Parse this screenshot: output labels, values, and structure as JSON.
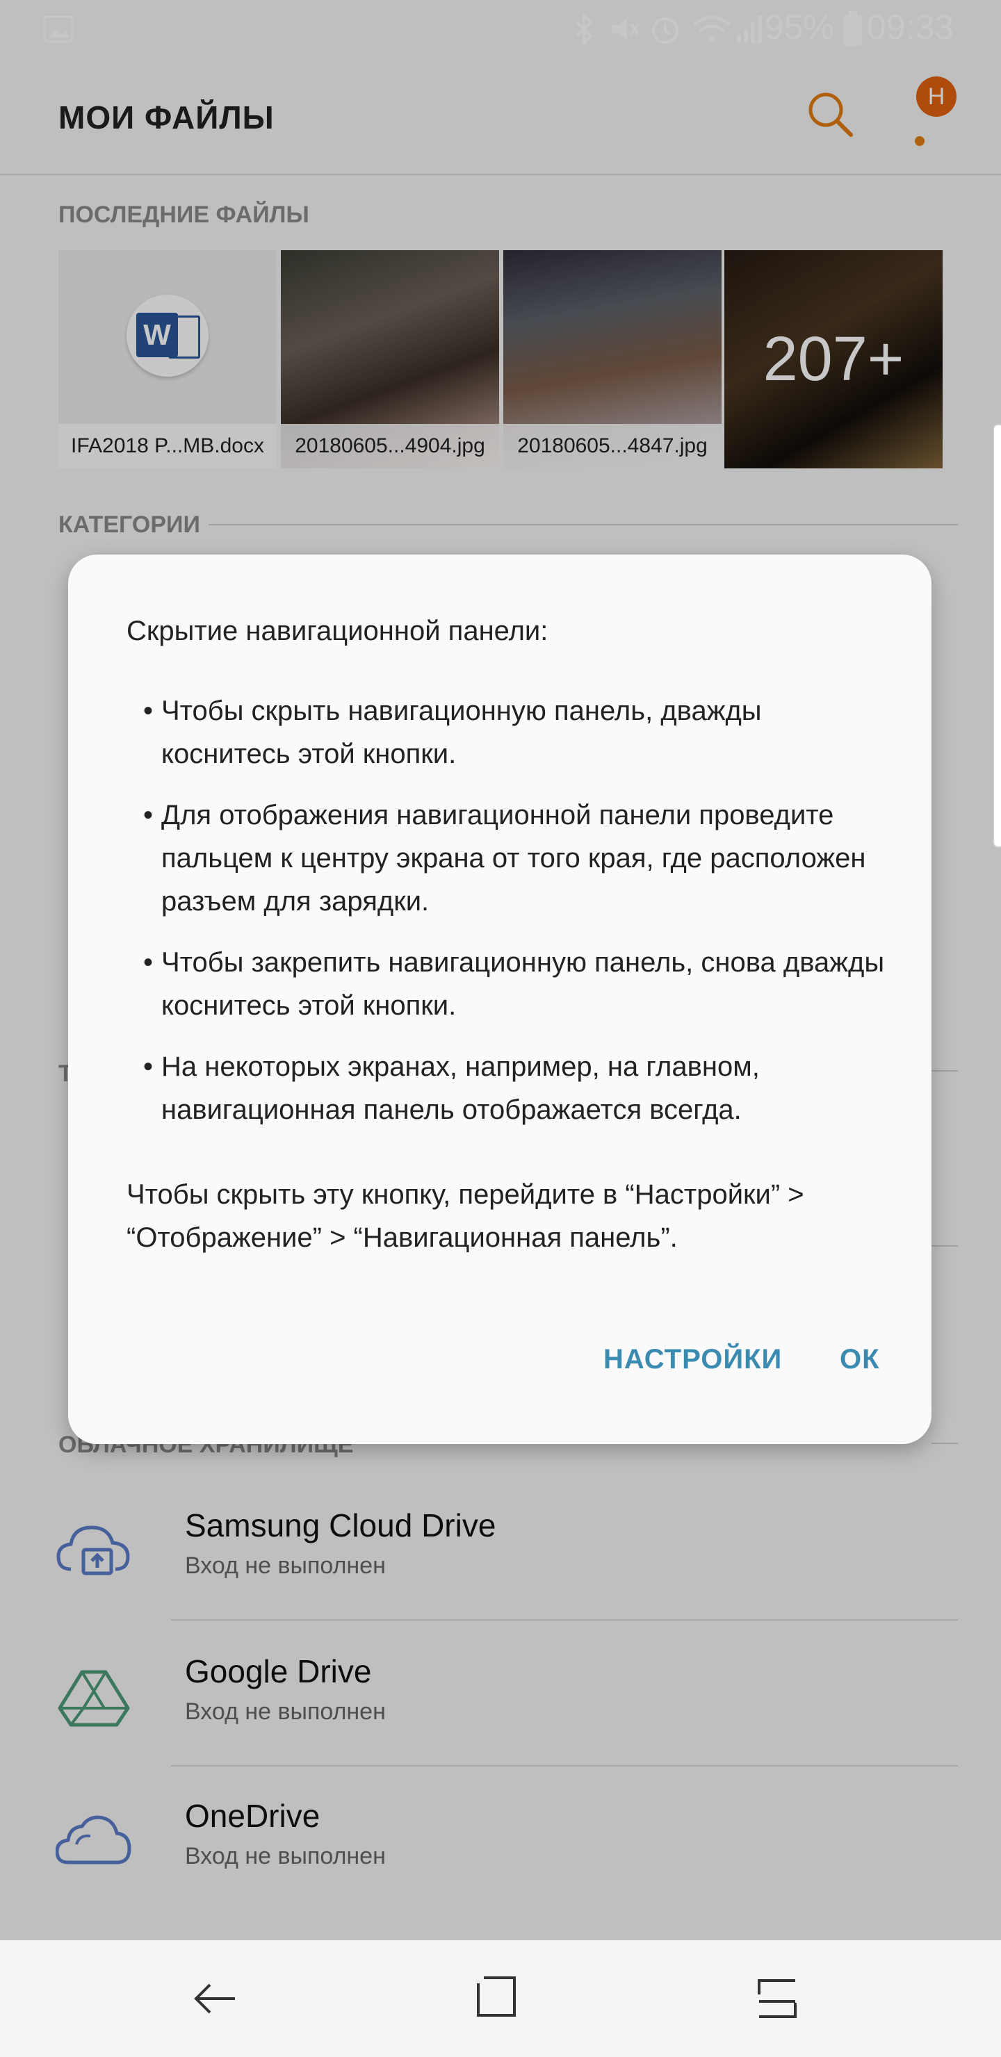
{
  "status_bar": {
    "battery": "95%",
    "time": "09:33"
  },
  "app_bar": {
    "title": "МОИ ФАЙЛЫ",
    "profile_initial": "Н"
  },
  "sections": {
    "recent": "ПОСЛЕДНИЕ ФАЙЛЫ",
    "categories": "КАТЕГОРИИ",
    "storage_partial": "Т",
    "cloud": "ОБЛАЧНОЕ ХРАНИЛИЩЕ"
  },
  "recent_files": [
    {
      "caption": "IFA2018 P...MB.docx"
    },
    {
      "caption": "20180605...4904.jpg"
    },
    {
      "caption": "20180605...4847.jpg"
    },
    {
      "more_count": "207+"
    }
  ],
  "cloud_services": [
    {
      "name": "Samsung Cloud Drive",
      "status": "Вход не выполнен"
    },
    {
      "name": "Google Drive",
      "status": "Вход не выполнен"
    },
    {
      "name": "OneDrive",
      "status": "Вход не выполнен"
    }
  ],
  "dialog": {
    "title": "Скрытие навигационной панели:",
    "bullets": [
      "Чтобы скрыть навигационную панель, дважды коснитесь этой кнопки.",
      "Для отображения навигационной панели проведите пальцем к центру экрана от того края, где расположен разъем для зарядки.",
      "Чтобы закрепить навигационную панель, снова дважды коснитесь этой кнопки.",
      "На некоторых экранах, например, на главном, навигационная панель отображается всегда."
    ],
    "footer": "Чтобы скрыть эту кнопку, перейдите в “Настройки” > “Отображение” > “Навигационная панель”.",
    "settings_button": "НАСТРОЙКИ",
    "ok_button": "ОК"
  },
  "colors": {
    "accent_orange": "#e07b12",
    "dialog_button": "#3b8ab0",
    "cloud_icon_blue": "#5a7bc7",
    "cloud_icon_green": "#4e9a78"
  }
}
